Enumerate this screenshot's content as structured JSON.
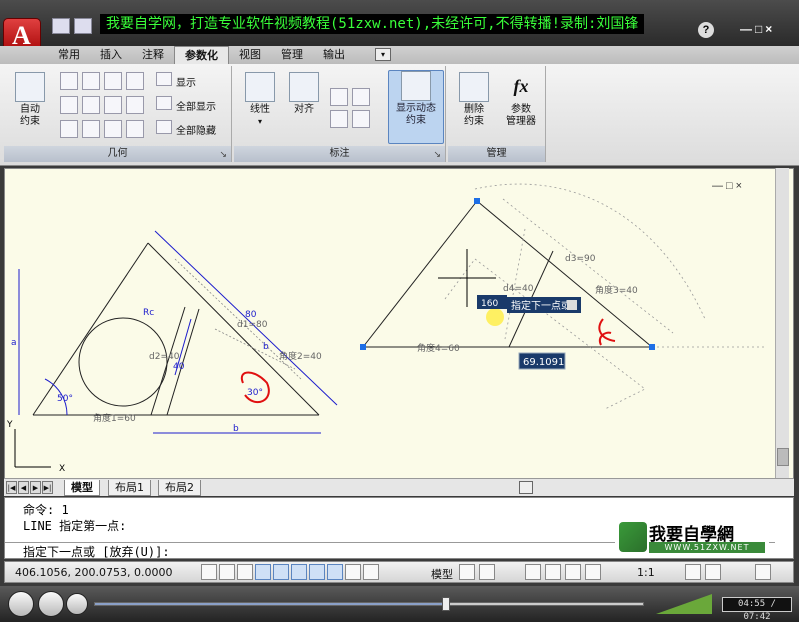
{
  "watermark": "我要自学网，打造专业软件视频教程(51zxw.net),未经许可,不得转播!录制:刘国锋",
  "app_letter": "A",
  "title_bar": {
    "help": "?",
    "controls": "—□×"
  },
  "tabs": [
    "常用",
    "插入",
    "注释",
    "参数化",
    "视图",
    "管理",
    "输出"
  ],
  "active_tab": "参数化",
  "ribbon": {
    "geometric_panel_title": "几何",
    "auto_constrain": "自动\n约束",
    "show": "显示",
    "show_all": "全部显示",
    "hide_all": "全部隐藏",
    "dimension_panel_title": "标注",
    "linear": "线性",
    "aligned": "对齐",
    "show_dynamic": "显示动态\n约束",
    "manage_panel_title": "管理",
    "delete_constraint": "删除\n约束",
    "param_manager": "参数\n管理器",
    "fx": "fx"
  },
  "canvas": {
    "controls": "—□×",
    "left_labels": {
      "rc": "Rc",
      "d1": "d1=80",
      "eighty": "80",
      "d2": "d2=40",
      "forty": "40",
      "b_side": "b",
      "angle2": "角度2=40",
      "angle1": "角度1=60",
      "angle_50": "50°",
      "angle_30": "30°",
      "a": "a",
      "b_bottom": "b"
    },
    "right_labels": {
      "d3": "d3=90",
      "d4": "d4=40",
      "angle3": "角度3=40",
      "angle4": "角度4=60"
    },
    "tooltip_prompt": "指定下一点或",
    "tooltip_value": "160",
    "length_input": "69.1091",
    "ucs_y": "Y",
    "ucs_x": "X"
  },
  "layout_tabs": [
    "模型",
    "布局1",
    "布局2"
  ],
  "active_layout": "模型",
  "command": {
    "line1": "命令: 1",
    "line2": "LINE 指定第一点:",
    "prompt": "指定下一点或 [放弃(U)]:"
  },
  "logo": {
    "text": "我要自學網",
    "url": "WWW.51ZXW.NET"
  },
  "status": {
    "coords": "406.1056, 200.0753, 0.0000",
    "model": "模型",
    "scale": "1:1"
  },
  "player": {
    "time": "04:55 / 07:42",
    "progress": 0.64
  }
}
